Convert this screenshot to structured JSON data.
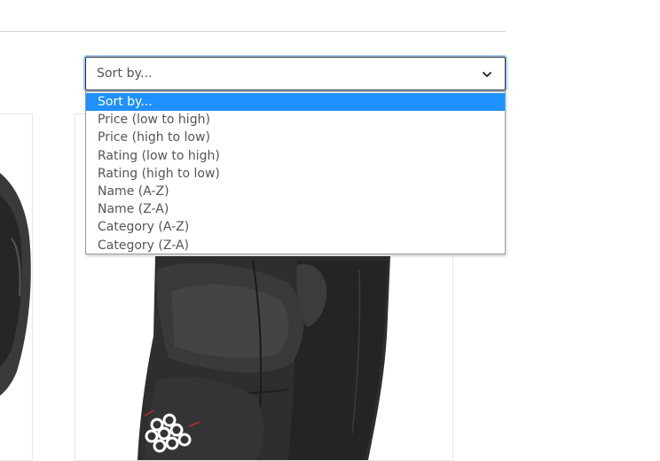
{
  "sort": {
    "selected_label": "Sort by...",
    "options": [
      "Sort by...",
      "Price (low to high)",
      "Price (high to low)",
      "Rating (low to high)",
      "Rating (high to low)",
      "Name (A-Z)",
      "Name (Z-A)",
      "Category (A-Z)",
      "Category (Z-A)"
    ],
    "highlighted_color": "#1e90ff"
  },
  "products": [
    {
      "image": "protective-pad-partial"
    },
    {
      "image": "padded-protective-shorts"
    }
  ]
}
